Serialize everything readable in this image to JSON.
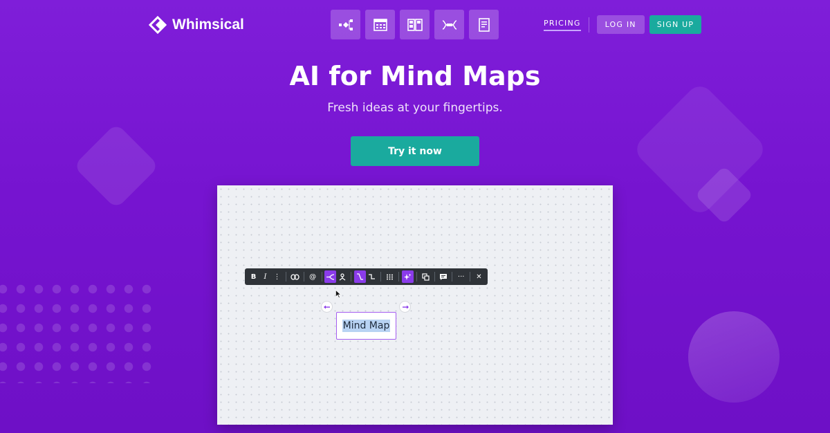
{
  "header": {
    "logo_text": "Whimsical",
    "tools": [
      {
        "name": "flowchart-icon"
      },
      {
        "name": "wireframe-icon"
      },
      {
        "name": "board-icon"
      },
      {
        "name": "mindmap-icon"
      },
      {
        "name": "doc-icon"
      }
    ],
    "pricing_label": "PRICING",
    "login_label": "LOG IN",
    "signup_label": "SIGN UP"
  },
  "hero": {
    "title": "AI for Mind Maps",
    "subtitle": "Fresh ideas at your fingertips.",
    "cta_label": "Try it now"
  },
  "editor": {
    "toolbar": {
      "bold": "B",
      "italic": "I",
      "more_text": "⋮",
      "mention": "@",
      "more": "···",
      "close": "✕"
    },
    "node_text": "Mind Map"
  },
  "colors": {
    "background": "#7614d0",
    "accent_teal": "#1aaa9e",
    "toolbar_active": "#8a3bea"
  }
}
